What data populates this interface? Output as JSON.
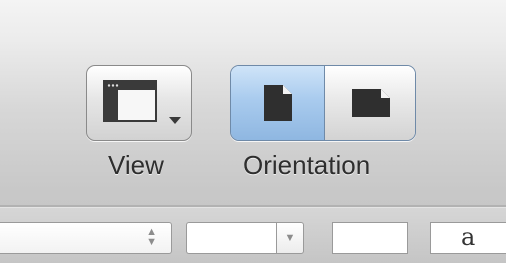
{
  "toolbar": {
    "view": {
      "label": "View",
      "icon": "sidebar-layout-icon"
    },
    "orientation": {
      "label": "Orientation",
      "options": [
        {
          "name": "portrait",
          "icon": "portrait-page-icon",
          "selected": true
        },
        {
          "name": "landscape",
          "icon": "landscape-page-icon",
          "selected": false
        }
      ]
    }
  },
  "format_bar": {
    "style_popup": {
      "value": ""
    },
    "combo": {
      "value": ""
    },
    "size_field": {
      "value": ""
    },
    "font_preview": {
      "value": "a"
    }
  },
  "colors": {
    "selected_segment": "#a9cbee",
    "button_border": "#8a8a8a",
    "label_text": "#2e2e2e"
  }
}
